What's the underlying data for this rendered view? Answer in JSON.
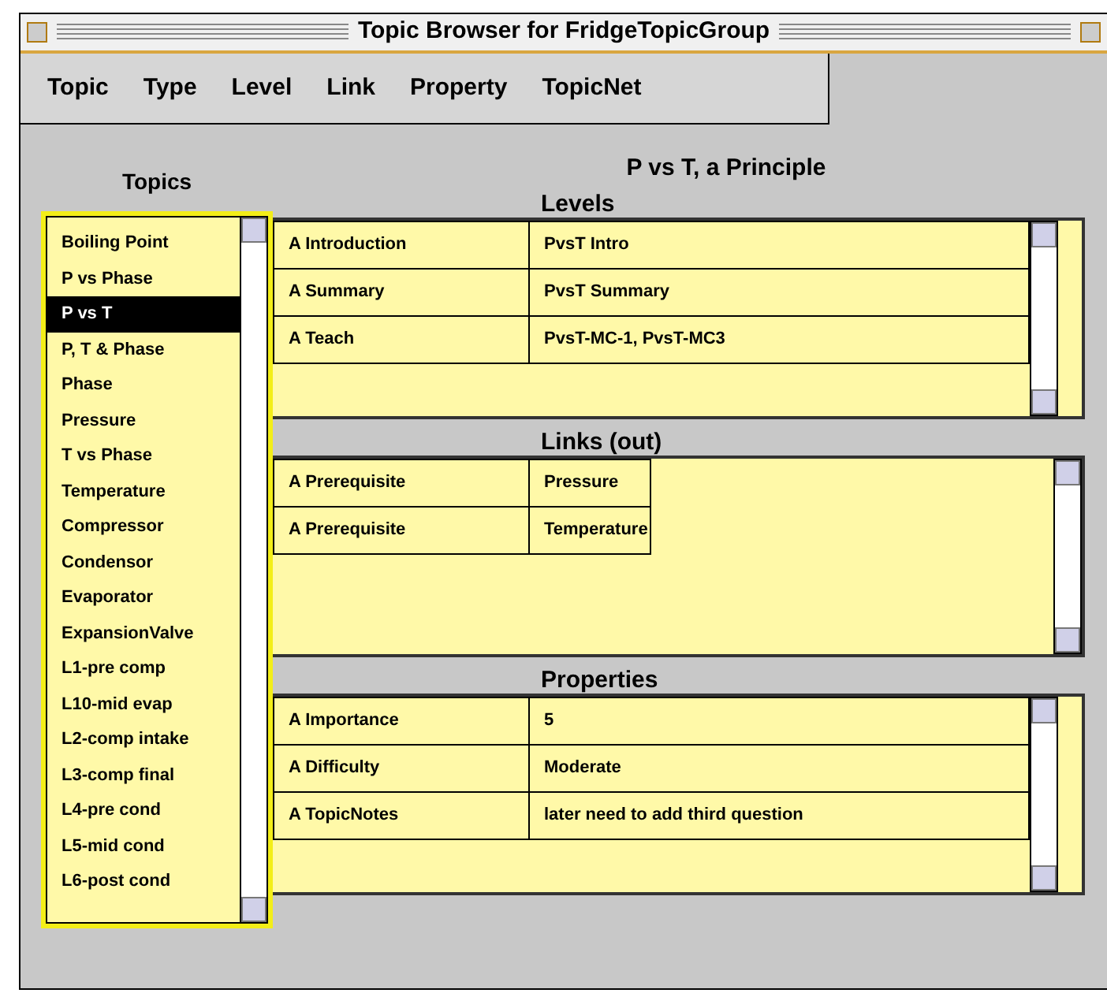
{
  "window": {
    "title": "Topic Browser for FridgeTopicGroup"
  },
  "menu": [
    "Topic",
    "Type",
    "Level",
    "Link",
    "Property",
    "TopicNet"
  ],
  "topics": {
    "heading": "Topics",
    "items": [
      {
        "label": "Boiling Point",
        "selected": false
      },
      {
        "label": "P vs Phase",
        "selected": false
      },
      {
        "label": "P vs T",
        "selected": true
      },
      {
        "label": "P, T & Phase",
        "selected": false
      },
      {
        "label": "Phase",
        "selected": false
      },
      {
        "label": "Pressure",
        "selected": false
      },
      {
        "label": "T vs Phase",
        "selected": false
      },
      {
        "label": "Temperature",
        "selected": false
      },
      {
        "label": "Compressor",
        "selected": false
      },
      {
        "label": "Condensor",
        "selected": false
      },
      {
        "label": "Evaporator",
        "selected": false
      },
      {
        "label": "ExpansionValve",
        "selected": false
      },
      {
        "label": "L1-pre comp",
        "selected": false
      },
      {
        "label": "L10-mid evap",
        "selected": false
      },
      {
        "label": "L2-comp intake",
        "selected": false
      },
      {
        "label": "L3-comp final",
        "selected": false
      },
      {
        "label": "L4-pre cond",
        "selected": false
      },
      {
        "label": "L5-mid cond",
        "selected": false
      },
      {
        "label": "L6-post cond",
        "selected": false
      }
    ]
  },
  "topic_title": "P vs T, a Principle",
  "sections": [
    {
      "heading": "Levels",
      "kind": "wide",
      "rows": [
        {
          "name": "A Introduction",
          "value": "PvsT Intro"
        },
        {
          "name": "A Summary",
          "value": "PvsT Summary"
        },
        {
          "name": "A Teach",
          "value": "PvsT-MC-1, PvsT-MC3"
        }
      ]
    },
    {
      "heading": "Links (out)",
      "kind": "narrow",
      "rows": [
        {
          "name": "A Prerequisite",
          "value": "Pressure"
        },
        {
          "name": "A Prerequisite",
          "value": "Temperature"
        }
      ]
    },
    {
      "heading": "Properties",
      "kind": "wide",
      "rows": [
        {
          "name": "A Importance",
          "value": "5"
        },
        {
          "name": "A Difficulty",
          "value": "Moderate"
        },
        {
          "name": "A TopicNotes",
          "value": "later need to add third question"
        }
      ]
    }
  ]
}
